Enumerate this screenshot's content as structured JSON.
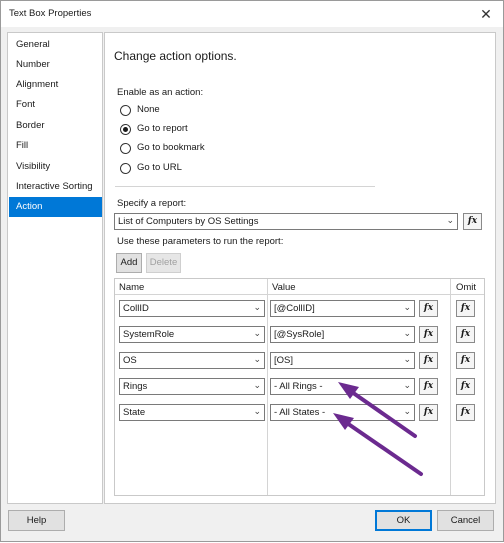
{
  "window": {
    "title": "Text Box Properties"
  },
  "nav": {
    "items": [
      {
        "label": "General"
      },
      {
        "label": "Number"
      },
      {
        "label": "Alignment"
      },
      {
        "label": "Font"
      },
      {
        "label": "Border"
      },
      {
        "label": "Fill"
      },
      {
        "label": "Visibility"
      },
      {
        "label": "Interactive Sorting"
      },
      {
        "label": "Action",
        "selected": true
      }
    ]
  },
  "action": {
    "heading": "Change action options.",
    "enable_label": "Enable as an action:",
    "options": [
      {
        "label": "None",
        "checked": false
      },
      {
        "label": "Go to report",
        "checked": true
      },
      {
        "label": "Go to bookmark",
        "checked": false
      },
      {
        "label": "Go to URL",
        "checked": false
      }
    ],
    "specify_label": "Specify a report:",
    "report_value": "List of Computers by OS Settings",
    "params_label": "Use these parameters to run the report:",
    "add_button": "Add",
    "delete_button": "Delete",
    "fx_label": "fx"
  },
  "grid": {
    "headers": {
      "name": "Name",
      "value": "Value",
      "omit": "Omit"
    },
    "rows": [
      {
        "name": "CollID",
        "value": "[@CollID]"
      },
      {
        "name": "SystemRole",
        "value": "[@SysRole]"
      },
      {
        "name": "OS",
        "value": "[OS]"
      },
      {
        "name": "Rings",
        "value": "- All Rings -"
      },
      {
        "name": "State",
        "value": "- All States -"
      }
    ]
  },
  "footer": {
    "help": "Help",
    "ok": "OK",
    "cancel": "Cancel"
  },
  "colors": {
    "accent": "#0078d7",
    "annotation_arrow": "#6b2a8f"
  }
}
